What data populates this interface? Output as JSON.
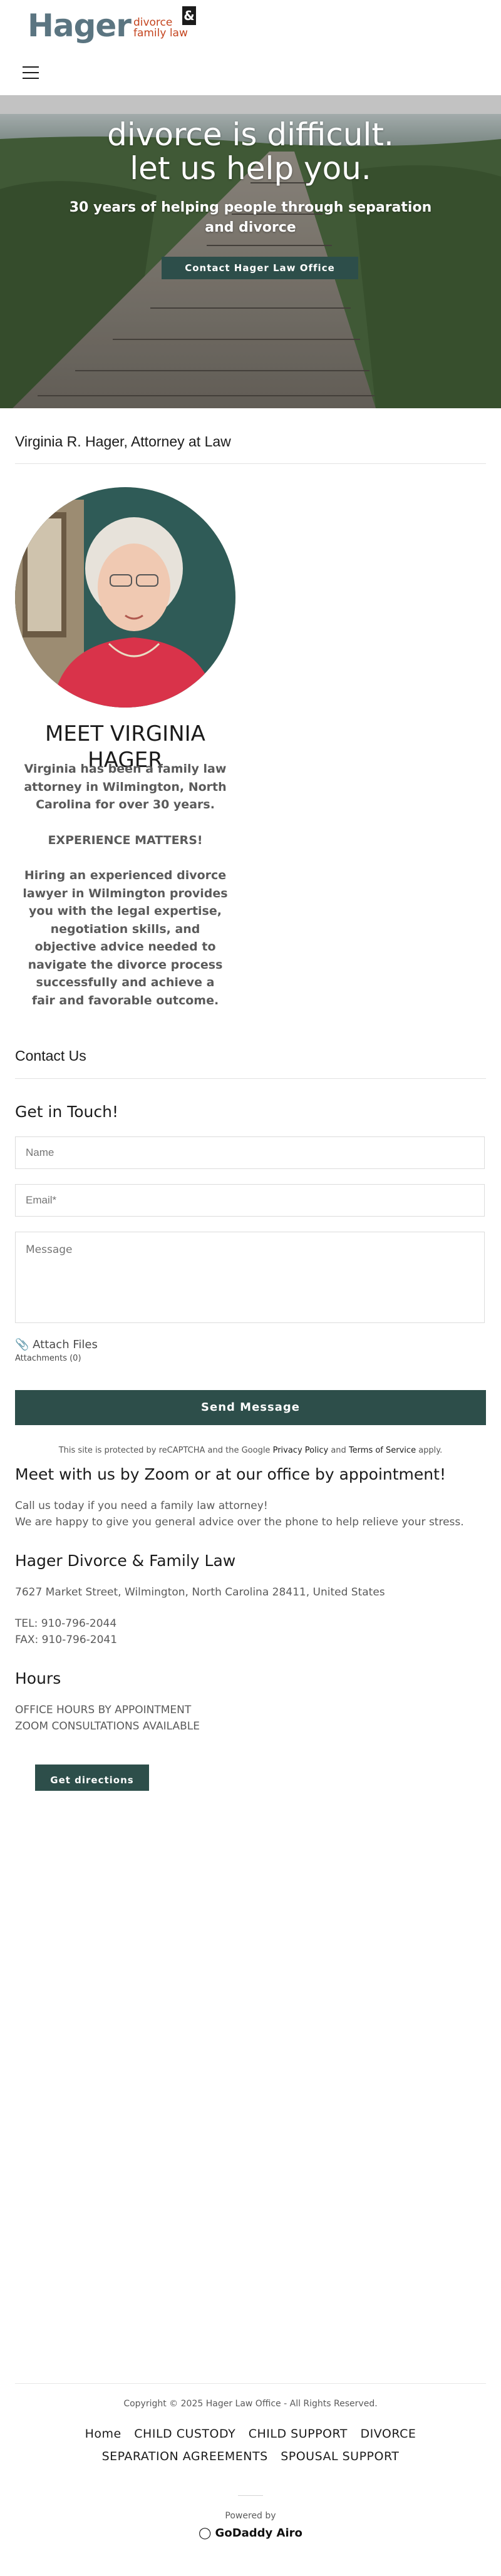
{
  "header": {
    "logo_word": "Hager",
    "logo_sub_1": "divorce",
    "logo_sub_2": "family law",
    "logo_amp": "&"
  },
  "hero": {
    "headline_1": "divorce is difficult.",
    "headline_2": "let us help you.",
    "subtitle": "30 years of helping people through separation and divorce",
    "cta": "Contact Hager Law Office"
  },
  "about": {
    "section_title": "Virginia R. Hager, Attorney at Law",
    "meet_title": "MEET VIRGINIA HAGER",
    "bio_1": "Virginia has been a family law attorney in Wilmington, North Carolina for over 30 years.",
    "bio_2": "EXPERIENCE MATTERS!",
    "bio_3": "Hiring an experienced divorce lawyer in Wilmington provides you with the legal expertise, negotiation skills, and objective advice needed to navigate the divorce process successfully and achieve a fair and favorable outcome."
  },
  "contact": {
    "section_title": "Contact Us",
    "form_title": "Get in Touch!",
    "name_placeholder": "Name",
    "email_placeholder": "Email*",
    "message_placeholder": "Message",
    "attach_label": "Attach Files",
    "attachments_count": "Attachments (0)",
    "send_label": "Send Message",
    "captcha_prefix": "This site is protected by reCAPTCHA and the Google",
    "privacy_link": "Privacy Policy",
    "captcha_and": "and",
    "terms_link": "Terms of Service",
    "captcha_suffix": "apply."
  },
  "info": {
    "zoom_title": "Meet with us by Zoom or at our office by appointment!",
    "zoom_line_1": "Call us today if you need a family law attorney!",
    "zoom_line_2": "We are happy to give you general advice over the phone to help relieve your stress.",
    "firm_name": "Hager Divorce & Family Law",
    "address": "7627 Market Street, Wilmington, North Carolina 28411, United States",
    "tel": "TEL: 910-796-2044",
    "fax": "FAX: 910-796-2041",
    "hours_title": "Hours",
    "hours_1": "OFFICE HOURS BY APPOINTMENT",
    "hours_2": "ZOOM CONSULTATIONS AVAILABLE",
    "directions_label": "Get directions"
  },
  "footer": {
    "copyright": "Copyright © 2025 Hager Law Office - All Rights Reserved.",
    "nav_row_1": [
      "Home",
      "CHILD CUSTODY",
      "CHILD SUPPORT",
      "DIVORCE"
    ],
    "nav_row_2": [
      "SEPARATION AGREEMENTS",
      "SPOUSAL SUPPORT"
    ],
    "powered_by": "Powered by",
    "brand": "GoDaddy Airo"
  },
  "colors": {
    "accent": "#2d4e4a",
    "logo_gray": "#5b7581",
    "logo_orange": "#c4441e"
  }
}
